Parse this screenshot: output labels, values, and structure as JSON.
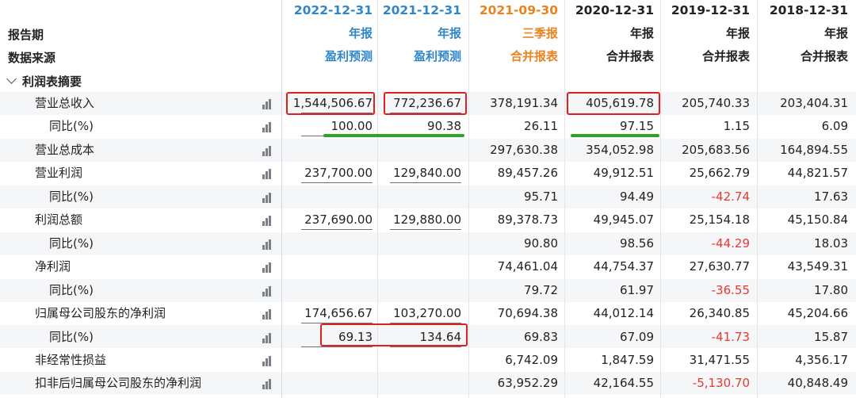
{
  "header": {
    "row1_label": "报告期",
    "row2_label": "数据来源",
    "columns": [
      {
        "date": "2022-12-31",
        "type": "年报",
        "source": "盈利预测",
        "color": "#2f86c8"
      },
      {
        "date": "2021-12-31",
        "type": "年报",
        "source": "盈利预测",
        "color": "#2f86c8"
      },
      {
        "date": "2021-09-30",
        "type": "三季报",
        "source": "合并报表",
        "color": "#e8831f"
      },
      {
        "date": "2020-12-31",
        "type": "年报",
        "source": "合并报表",
        "color": "#222222"
      },
      {
        "date": "2019-12-31",
        "type": "年报",
        "source": "合并报表",
        "color": "#222222"
      },
      {
        "date": "2018-12-31",
        "type": "年报",
        "source": "合并报表",
        "color": "#222222"
      }
    ]
  },
  "section": {
    "title": "利润表摘要"
  },
  "rows": [
    {
      "label": "营业总收入",
      "indent": false,
      "values": [
        "1,544,506.67",
        "772,236.67",
        "378,191.34",
        "405,619.78",
        "205,740.33",
        "203,404.31"
      ]
    },
    {
      "label": "同比(%)",
      "indent": true,
      "values": [
        "100.00",
        "90.38",
        "26.11",
        "97.15",
        "1.15",
        "6.09"
      ]
    },
    {
      "label": "营业总成本",
      "indent": false,
      "values": [
        "",
        "",
        "297,630.38",
        "354,052.98",
        "205,683.56",
        "164,894.55"
      ]
    },
    {
      "label": "营业利润",
      "indent": false,
      "values": [
        "237,700.00",
        "129,840.00",
        "89,457.26",
        "49,912.51",
        "25,662.79",
        "44,821.57"
      ]
    },
    {
      "label": "同比(%)",
      "indent": true,
      "values": [
        "",
        "",
        "95.71",
        "94.49",
        "-42.74",
        "17.63"
      ]
    },
    {
      "label": "利润总额",
      "indent": false,
      "values": [
        "237,690.00",
        "129,880.00",
        "89,378.73",
        "49,945.07",
        "25,154.18",
        "45,150.84"
      ]
    },
    {
      "label": "同比(%)",
      "indent": true,
      "values": [
        "",
        "",
        "90.80",
        "98.56",
        "-44.29",
        "18.03"
      ]
    },
    {
      "label": "净利润",
      "indent": false,
      "values": [
        "",
        "",
        "74,461.04",
        "44,754.37",
        "27,630.77",
        "43,549.31"
      ]
    },
    {
      "label": "同比(%)",
      "indent": true,
      "values": [
        "",
        "",
        "79.72",
        "61.97",
        "-36.55",
        "17.80"
      ]
    },
    {
      "label": "归属母公司股东的净利润",
      "indent": false,
      "values": [
        "174,656.67",
        "103,270.00",
        "70,694.38",
        "44,012.14",
        "26,340.85",
        "45,204.66"
      ]
    },
    {
      "label": "同比(%)",
      "indent": true,
      "values": [
        "69.13",
        "134.64",
        "69.83",
        "67.09",
        "-41.73",
        "15.87"
      ]
    },
    {
      "label": "非经常性损益",
      "indent": false,
      "values": [
        "",
        "",
        "6,742.09",
        "1,847.59",
        "31,471.55",
        "4,356.17"
      ]
    },
    {
      "label": "扣非后归属母公司股东的净利润",
      "indent": false,
      "values": [
        "",
        "",
        "63,952.29",
        "42,164.55",
        "-5,130.70",
        "40,848.49"
      ]
    }
  ],
  "icons": {
    "chart": "bar-chart-icon",
    "expand": "chevron-down-icon"
  },
  "colors": {
    "forecast_header": "#2f86c8",
    "quarterly_header": "#e8831f",
    "negative": "#e8382f",
    "highlight_box": "#e02020",
    "highlight_underline": "#2aa52a"
  }
}
